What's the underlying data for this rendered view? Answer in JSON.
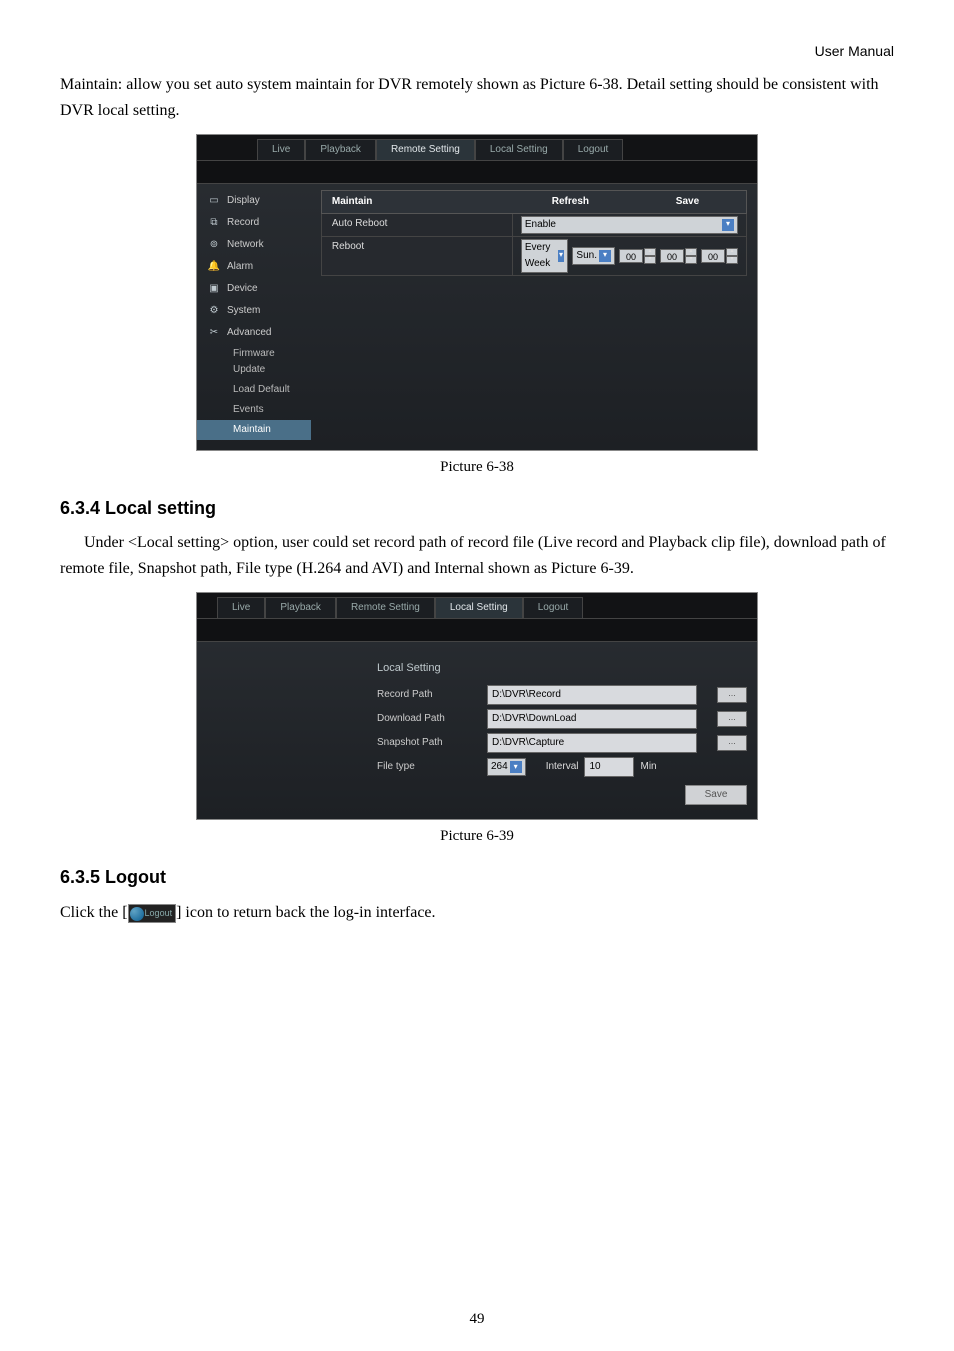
{
  "header": "User  Manual",
  "para_intro": "Maintain: allow you set auto system maintain for DVR remotely shown as Picture 6-38. Detail setting should be consistent with DVR local setting.",
  "shot1": {
    "tabs": [
      "Live",
      "Playback",
      "Remote Setting",
      "Local Setting",
      "Logout"
    ],
    "sidebar": [
      "Display",
      "Record",
      "Network",
      "Alarm",
      "Device",
      "System",
      "Advanced"
    ],
    "subs": [
      "Firmware Update",
      "Load Default",
      "Events",
      "Maintain"
    ],
    "panel": {
      "title": "Maintain",
      "btn_refresh": "Refresh",
      "btn_save": "Save",
      "row1_label": "Auto Reboot",
      "row1_value": "Enable",
      "row2_label": "Reboot",
      "row2_sel1": "Every Week",
      "row2_sel2": "Sun.",
      "row2_h": "00",
      "row2_m": "00",
      "row2_s": "00"
    }
  },
  "caption1": "Picture 6-38",
  "h2_a": "6.3.4 Local setting",
  "para_local": "Under <Local setting> option, user could set record path of record file (Live record and Playback clip file), download path of remote file, Snapshot path, File type (H.264 and AVI) and Internal shown as Picture 6-39.",
  "shot2": {
    "tabs": [
      "Live",
      "Playback",
      "Remote Setting",
      "Local Setting",
      "Logout"
    ],
    "head": "Local Setting",
    "rows": {
      "record_lbl": "Record Path",
      "record_val": "D:\\DVR\\Record",
      "download_lbl": "Download Path",
      "download_val": "D:\\DVR\\DownLoad",
      "snapshot_lbl": "Snapshot Path",
      "snapshot_val": "D:\\DVR\\Capture",
      "filetype_lbl": "File type",
      "filetype_val": "264",
      "interval_lbl": "Interval",
      "interval_val": "10",
      "interval_unit": "Min",
      "save_btn": "Save"
    }
  },
  "caption2": "Picture 6-39",
  "h2_b": "6.3.5 Logout",
  "logout_pre": "Click the [",
  "logout_label": "Logout",
  "logout_post": "] icon to return back the log-in interface.",
  "pagenum": "49"
}
